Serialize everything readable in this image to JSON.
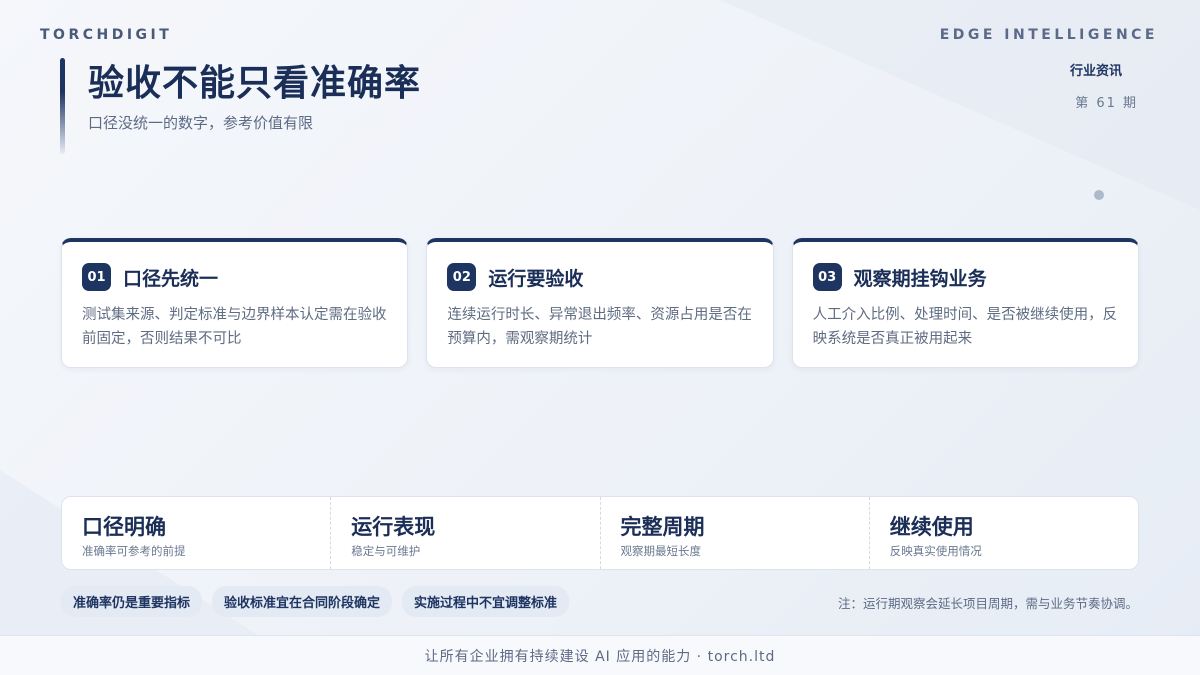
{
  "brand": {
    "left": "TORCHDIGIT",
    "right": "EDGE INTELLIGENCE"
  },
  "header": {
    "title": "验收不能只看准确率",
    "subtitle": "口径没统一的数字，参考价值有限",
    "tag": "行业资讯",
    "issue": "第 61 期"
  },
  "cards": [
    {
      "num": "01",
      "title": "口径先统一",
      "desc": "测试集来源、判定标准与边界样本认定需在验收前固定，否则结果不可比"
    },
    {
      "num": "02",
      "title": "运行要验收",
      "desc": "连续运行时长、异常退出频率、资源占用是否在预算内，需观察期统计"
    },
    {
      "num": "03",
      "title": "观察期挂钩业务",
      "desc": "人工介入比例、处理时间、是否被继续使用，反映系统是否真正被用起来"
    }
  ],
  "metrics": [
    {
      "title": "口径明确",
      "sub": "准确率可参考的前提"
    },
    {
      "title": "运行表现",
      "sub": "稳定与可维护"
    },
    {
      "title": "完整周期",
      "sub": "观察期最短长度"
    },
    {
      "title": "继续使用",
      "sub": "反映真实使用情况"
    }
  ],
  "pills": [
    "准确率仍是重要指标",
    "验收标准宜在合同阶段确定",
    "实施过程中不宜调整标准"
  ],
  "note": "注：运行期观察会延长项目周期，需与业务节奏协调。",
  "footer": "让所有企业拥有持续建设 AI 应用的能力  ·  torch.ltd",
  "colors": {
    "primary": "#1e3461",
    "muted": "#5d6b85",
    "card_bg": "#ffffff",
    "pill_bg": "#e4eaf4"
  }
}
